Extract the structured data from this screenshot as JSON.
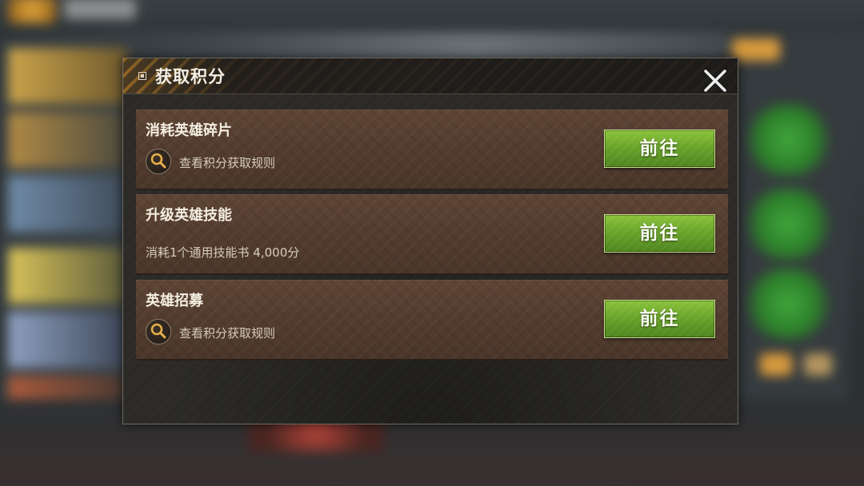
{
  "modal": {
    "title": "获取积分",
    "close_icon": "close-x-icon",
    "rows": [
      {
        "title": "消耗英雄碎片",
        "link_text": "查看积分获取规则",
        "link_icon": "magnifier-icon",
        "button_label": "前往"
      },
      {
        "title": "升级英雄技能",
        "subtitle": "消耗1个通用技能书 4,000分",
        "button_label": "前往"
      },
      {
        "title": "英雄招募",
        "link_text": "查看积分获取规则",
        "link_icon": "magnifier-icon",
        "button_label": "前往"
      }
    ]
  },
  "colors": {
    "accent_green": "#6aa52b",
    "row_brown": "#533c2f",
    "title_text": "#f2eee4"
  }
}
